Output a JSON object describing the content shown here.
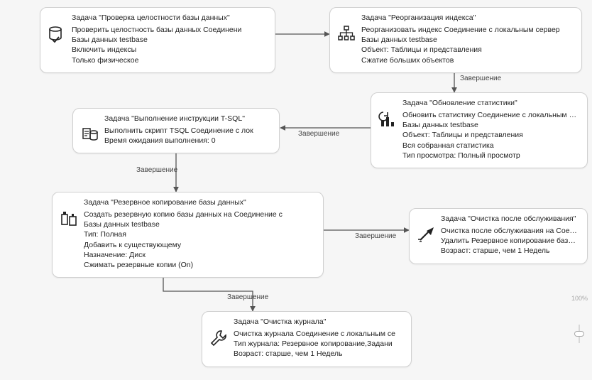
{
  "labels": {
    "completion": "Завершение"
  },
  "nodes": {
    "checkIntegrity": {
      "title": "Задача \"Проверка целостности базы данных\"",
      "lines": [
        "Проверить целостность базы данных Соединени",
        "Базы данных testbase",
        "Включить индексы",
        "Только физическое"
      ]
    },
    "reorgIndex": {
      "title": "Задача \"Реорганизация индекса\"",
      "lines": [
        "Реорганизовать индекс Соединение с локальным сервер",
        "Базы данных testbase",
        "Объект: Таблицы и представления",
        "Сжатие больших объектов"
      ]
    },
    "updateStats": {
      "title": "Задача \"Обновление статистики\"",
      "lines": [
        "Обновить статистику Соединение с локальным сервером",
        "Базы данных testbase",
        "Объект: Таблицы и представления",
        "Вся собранная статистика",
        "Тип просмотра: Полный просмотр"
      ]
    },
    "execTsql": {
      "title": "Задача \"Выполнение инструкции T-SQL\"",
      "lines": [
        "Выполнить скрипт TSQL Соединение с лок",
        "Время ожидания выполнения: 0"
      ]
    },
    "backup": {
      "title": "Задача \"Резервное копирование базы данных\"",
      "lines": [
        "Создать резервную копию базы данных на Соединение с",
        "Базы данных testbase",
        "Тип: Полная",
        "Добавить к существующему",
        "Назначение: Диск",
        "Сжимать резервные копии (On)"
      ]
    },
    "maintCleanup": {
      "title": "Задача \"Очистка после обслуживания\"",
      "lines": [
        "Очистка после обслуживания на Соединение с локаль",
        "Удалить Резервное копирование базы данных файлов",
        "Возраст: старше, чем 1 Недель"
      ]
    },
    "historyCleanup": {
      "title": "Задача \"Очистка журнала\"",
      "lines": [
        "Очистка журнала Соединение с локальным се",
        "Тип журнала: Резервное копирование,Задани",
        "Возраст: старше, чем 1 Недель"
      ]
    }
  },
  "zoom": {
    "percent": "100%"
  }
}
